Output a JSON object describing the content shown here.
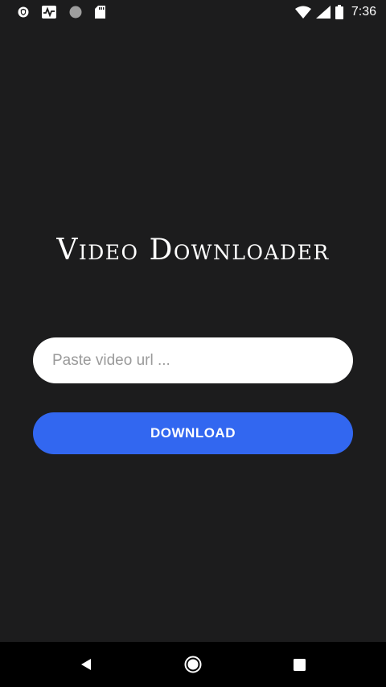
{
  "status_bar": {
    "time": "7:36",
    "left_icons": [
      "shield-icon",
      "activity-icon",
      "circle-icon",
      "sd-card-icon"
    ],
    "right_icons": [
      "wifi-icon",
      "cell-signal-icon",
      "battery-icon"
    ]
  },
  "app": {
    "title": "Video Downloader"
  },
  "url_field": {
    "value": "",
    "placeholder": "Paste video url ..."
  },
  "download_button": {
    "label": "DOWNLOAD",
    "color": "#3267f0"
  },
  "nav_bar": {
    "icons": [
      "back-icon",
      "home-icon",
      "recents-icon"
    ]
  },
  "colors": {
    "background": "#1c1c1d",
    "accent": "#3267f0",
    "nav_background": "#000000"
  }
}
